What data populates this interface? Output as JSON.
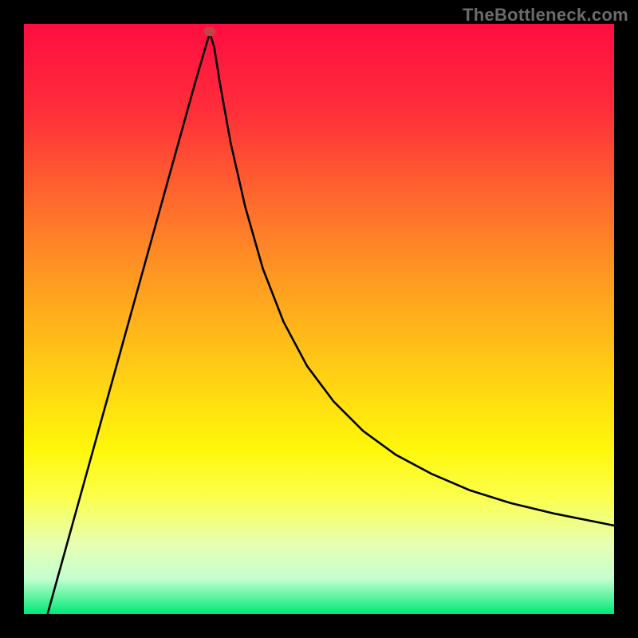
{
  "watermark": "TheBottleneck.com",
  "chart_data": {
    "type": "line",
    "title": "",
    "xlabel": "",
    "ylabel": "",
    "xlim": [
      0,
      100
    ],
    "ylim": [
      0,
      100
    ],
    "gradient_stops": [
      {
        "offset": 0,
        "color": "#ff0d41"
      },
      {
        "offset": 15,
        "color": "#ff2f3a"
      },
      {
        "offset": 30,
        "color": "#ff6a2d"
      },
      {
        "offset": 45,
        "color": "#ffa020"
      },
      {
        "offset": 60,
        "color": "#ffd114"
      },
      {
        "offset": 72,
        "color": "#fff70a"
      },
      {
        "offset": 80,
        "color": "#fbff4a"
      },
      {
        "offset": 88,
        "color": "#e7ffb0"
      },
      {
        "offset": 94,
        "color": "#c4ffd0"
      },
      {
        "offset": 100,
        "color": "#00e777"
      }
    ],
    "annotations": [
      {
        "kind": "marker",
        "x": 31.5,
        "y": 98.7,
        "color": "#c24444",
        "r": 1.0
      }
    ],
    "series": [
      {
        "name": "bottleneck-curve",
        "x": [
          4.0,
          6.5,
          9.0,
          11.5,
          14.0,
          16.5,
          19.0,
          21.5,
          24.0,
          26.5,
          29.0,
          30.75,
          31.5,
          32.25,
          33.2,
          35.0,
          37.5,
          40.5,
          44.0,
          48.0,
          52.5,
          57.5,
          63.0,
          69.0,
          75.5,
          82.5,
          90.0,
          100.0
        ],
        "y": [
          0.0,
          9.0,
          18.0,
          27.0,
          36.0,
          45.0,
          54.0,
          63.0,
          72.0,
          81.0,
          90.0,
          96.0,
          98.5,
          96.0,
          90.0,
          80.0,
          69.0,
          58.5,
          49.5,
          42.0,
          36.0,
          31.0,
          27.0,
          23.8,
          21.0,
          18.8,
          17.0,
          15.0
        ]
      }
    ]
  }
}
